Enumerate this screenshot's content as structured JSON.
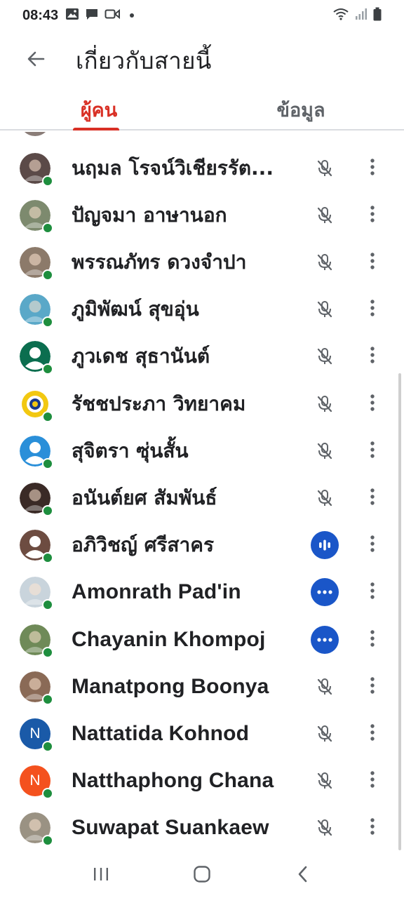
{
  "status_bar": {
    "time": "08:43",
    "icons": [
      "image-icon",
      "message-icon",
      "video-icon",
      "dot-icon",
      "wifi-icon",
      "signal-icon",
      "battery-icon"
    ]
  },
  "app_bar": {
    "title": "เกี่ยวกับสายนี้",
    "back_icon": "arrow-back-icon"
  },
  "tabs": [
    {
      "label": "ผู้คน",
      "active": true
    },
    {
      "label": "ข้อมูล",
      "active": false
    }
  ],
  "colors": {
    "accent": "#d93025",
    "presence": "#1e8e3e",
    "speaking": "#1a56c8",
    "muted_icon": "#5f6368"
  },
  "participants": [
    {
      "name": "นฤมล โรจน์วิเชียรรัต...",
      "status": "muted",
      "avatar": "photo",
      "avatar_color": "#5b4a48"
    },
    {
      "name": "ปัญจมา อาษานอก",
      "status": "muted",
      "avatar": "photo",
      "avatar_color": "#7d8a6e"
    },
    {
      "name": "พรรณภัทร ดวงจำปา",
      "status": "muted",
      "avatar": "photo",
      "avatar_color": "#8c7a6a"
    },
    {
      "name": "ภูมิพัฒน์ สุขอุ่น",
      "status": "muted",
      "avatar": "photo",
      "avatar_color": "#5aa8c8"
    },
    {
      "name": "ภูวเดช สุธานันต์",
      "status": "muted",
      "avatar": "default",
      "avatar_color": "#0b6e4f"
    },
    {
      "name": "รัชชประภา วิทยาคม",
      "status": "muted",
      "avatar": "logo",
      "avatar_color": "#f2c811"
    },
    {
      "name": "สุจิตรา ซุ่นสั้น",
      "status": "muted",
      "avatar": "default",
      "avatar_color": "#2a8fd9"
    },
    {
      "name": "อนันต์ยศ สัมพันธ์",
      "status": "muted",
      "avatar": "photo",
      "avatar_color": "#3a2a26"
    },
    {
      "name": "อภิวิชญ์ ศรีสาคร",
      "status": "speaking",
      "avatar": "default",
      "avatar_color": "#6d4c41"
    },
    {
      "name": "Amonrath Pad'in",
      "status": "more",
      "avatar": "photo",
      "avatar_color": "#c9d4dc"
    },
    {
      "name": "Chayanin Khompoj",
      "status": "more",
      "avatar": "photo",
      "avatar_color": "#6f8a58"
    },
    {
      "name": "Manatpong Boonya",
      "status": "muted",
      "avatar": "photo",
      "avatar_color": "#8a6a56"
    },
    {
      "name": "Nattatida Kohnod",
      "status": "muted",
      "avatar": "letter",
      "letter": "N",
      "avatar_color": "#1a5aa8"
    },
    {
      "name": "Natthaphong Chana",
      "status": "muted",
      "avatar": "letter",
      "letter": "N",
      "avatar_color": "#f4511e"
    },
    {
      "name": "Suwapat Suankaew",
      "status": "muted",
      "avatar": "photo",
      "avatar_color": "#9a9283"
    }
  ],
  "nav_bar": {
    "items": [
      "recents-icon",
      "home-icon",
      "back-icon"
    ]
  }
}
